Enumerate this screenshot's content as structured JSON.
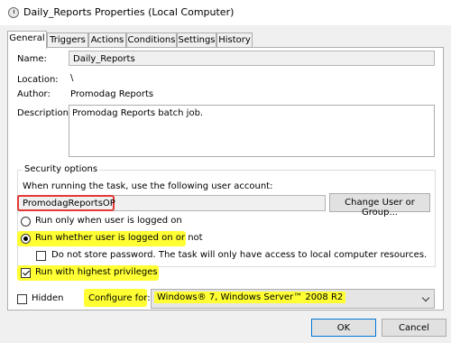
{
  "window": {
    "title": "Daily_Reports Properties (Local Computer)",
    "icon": "clock-icon"
  },
  "tabs": [
    "General",
    "Triggers",
    "Actions",
    "Conditions",
    "Settings",
    "History"
  ],
  "general": {
    "name_label": "Name:",
    "name_value": "Daily_Reports",
    "location_label": "Location:",
    "location_value": "\\",
    "author_label": "Author:",
    "author_value": "Promodag Reports",
    "description_label": "Description:",
    "description_value": "Promodag Reports batch job."
  },
  "security": {
    "group_label": "Security options",
    "account_prompt": "When running the task, use the following user account:",
    "account_value": "PromodagReportsOP",
    "change_button": "Change User or Group...",
    "radio_logged_on": "Run only when user is logged on",
    "radio_whether": "Run whether user is logged on or not",
    "radio_selected": "whether",
    "no_store_password": "Do not store password.  The task will only have access to local computer resources.",
    "no_store_checked": false,
    "highest_privileges": "Run with highest privileges",
    "highest_checked": true
  },
  "bottom": {
    "hidden_label": "Hidden",
    "hidden_checked": false,
    "configure_label": "Configure for:",
    "configure_value": "Windows® 7, Windows Server™ 2008 R2"
  },
  "buttons": {
    "ok": "OK",
    "cancel": "Cancel"
  },
  "colors": {
    "highlight": "#ffff33",
    "highlight_border": "#e53935"
  }
}
